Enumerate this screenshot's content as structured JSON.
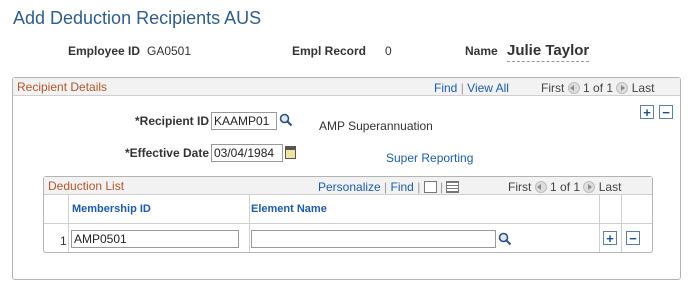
{
  "page": {
    "title": "Add Deduction Recipients AUS"
  },
  "header": {
    "employee_id_label": "Employee ID",
    "employee_id_value": "GA0501",
    "empl_record_label": "Empl Record",
    "empl_record_value": "0",
    "name_label": "Name",
    "name_value": "Julie Taylor"
  },
  "recipient_details": {
    "title": "Recipient Details",
    "find": "Find",
    "separator": "|",
    "view_all": "View All",
    "first": "First",
    "page_indicator": "1 of 1",
    "last": "Last",
    "recipient_id_label": "*Recipient ID",
    "recipient_id_value": "KAAMP01",
    "recipient_name": "AMP Superannuation",
    "effective_date_label": "*Effective Date",
    "effective_date_value": "03/04/1984",
    "super_reporting_link": "Super Reporting"
  },
  "deduction_list": {
    "title": "Deduction List",
    "personalize": "Personalize",
    "find": "Find",
    "separator": "|",
    "first": "First",
    "page_indicator": "1 of 1",
    "last": "Last",
    "columns": [
      "Membership ID",
      "Element Name"
    ],
    "rows": [
      {
        "row_number": "1",
        "membership_id": "AMP0501",
        "element_name": ""
      }
    ]
  },
  "icons": {
    "lookup": "magnifier-icon",
    "calendar": "calendar-icon",
    "add": "plus-icon",
    "delete": "minus-icon",
    "prev": "chevron-left-icon",
    "next": "chevron-right-icon",
    "new_window": "new-window-icon",
    "grid": "grid-icon"
  },
  "colors": {
    "title_blue": "#2e5d8c",
    "section_orange": "#b5562b",
    "link_blue": "#1c5bb0"
  }
}
